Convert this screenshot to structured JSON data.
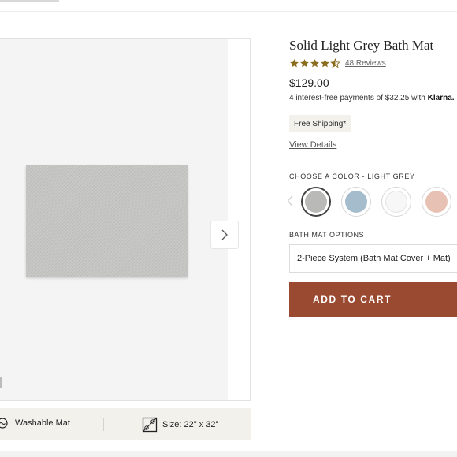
{
  "product": {
    "title": "Solid Light Grey Bath Mat",
    "rating": 4.5,
    "reviews": "48 Reviews",
    "price": "$129.00",
    "installment_text": "4 interest-free payments of $32.25 with",
    "installment_brand": "Klarna.",
    "shipping_badge": "Free Shipping*",
    "view_details": "View Details"
  },
  "color": {
    "label": "CHOOSE A COLOR - LIGHT GREY",
    "swatches": [
      {
        "name": "light-grey",
        "hex": "#b9b9b7",
        "selected": true
      },
      {
        "name": "light-blue",
        "hex": "#a5bccd",
        "selected": false
      },
      {
        "name": "white",
        "hex": "#f7f7f7",
        "selected": false
      },
      {
        "name": "blush",
        "hex": "#e8c1b5",
        "selected": false
      }
    ]
  },
  "options": {
    "label": "BATH MAT OPTIONS",
    "selected": "2-Piece System (Bath Mat Cover + Mat)"
  },
  "cart": {
    "label": "ADD TO CART",
    "color": "#9a4a31"
  },
  "features": [
    {
      "icon": "washable-icon",
      "label": "Washable Mat"
    },
    {
      "icon": "size-icon",
      "label": "Size: 22\" x 32\""
    }
  ],
  "colors": {
    "star": "#8a6d1f",
    "feature_bar": "#f3f1ec",
    "shipping_bg": "#f3f1ec"
  }
}
